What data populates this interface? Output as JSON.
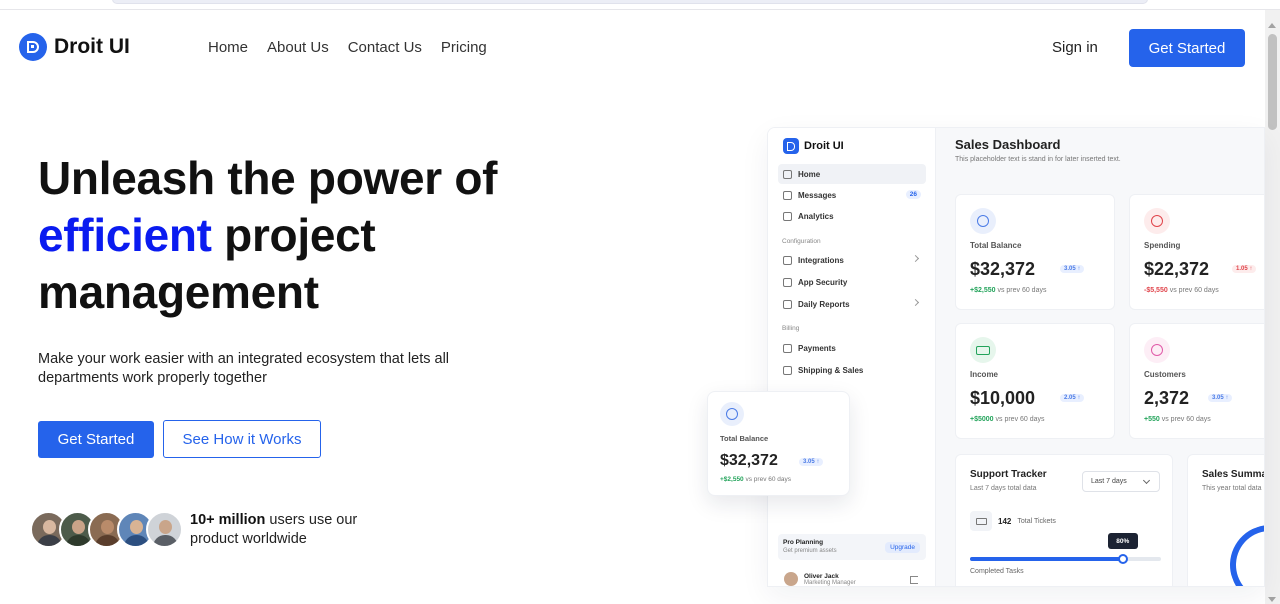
{
  "nav": {
    "brand": "Droit UI",
    "links": [
      "Home",
      "About Us",
      "Contact Us",
      "Pricing"
    ],
    "signin": "Sign in",
    "cta": "Get Started"
  },
  "hero": {
    "title_line1": "Unleash the power of",
    "title_accent": "efficient",
    "title_rest": " project",
    "title_line3": "management",
    "subtitle": "Make your work easier with an integrated ecosystem that lets all departments work properly together",
    "primary_button": "Get Started",
    "secondary_button": "See How it Works",
    "social_bold": "10+ million",
    "social_rest": " users use our product worldwide"
  },
  "dashboard": {
    "brand": "Droit UI",
    "sidebar": {
      "items": [
        {
          "label": "Home",
          "icon": "home-icon"
        },
        {
          "label": "Messages",
          "icon": "message-icon",
          "badge": "26"
        },
        {
          "label": "Analytics",
          "icon": "chart-icon"
        }
      ],
      "section_config": "Configuration",
      "config_items": [
        {
          "label": "Integrations",
          "icon": "puzzle-icon"
        },
        {
          "label": "App Security",
          "icon": "shield-icon"
        },
        {
          "label": "Daily Reports",
          "icon": "report-icon"
        }
      ],
      "section_billing": "Billing",
      "billing_items": [
        {
          "label": "Payments",
          "icon": "payments-icon"
        },
        {
          "label": "Shipping & Sales",
          "icon": "box-icon"
        }
      ],
      "plan_title": "Pro Planning",
      "plan_sub": "Get premium assets",
      "plan_button": "Upgrade",
      "user_name": "Oliver Jack",
      "user_role": "Marketing Manager"
    },
    "title": "Sales Dashboard",
    "subtitle": "This placeholder text is stand in for later inserted text.",
    "cards": [
      {
        "label": "Total Balance",
        "value": "$32,372",
        "chip": "3.05 ↑",
        "delta": "+$2,550",
        "foot": " vs prev 60 days",
        "tone": "pos",
        "icon": "database-icon"
      },
      {
        "label": "Spending",
        "value": "$22,372",
        "chip": "1.05 ↑",
        "delta": "-$5,550",
        "foot": " vs prev 60 days",
        "tone": "neg",
        "icon": "dollar-icon"
      },
      {
        "label": "Income",
        "value": "$10,000",
        "chip": "2.05 ↑",
        "delta": "+$5000",
        "foot": " vs prev 60 days",
        "tone": "pos",
        "icon": "cash-icon"
      },
      {
        "label": "Customers",
        "value": "2,372",
        "chip": "3.05 ↑",
        "delta": "+550",
        "foot": " vs prev 60 days",
        "tone": "pos",
        "icon": "users-icon"
      }
    ],
    "tracker": {
      "title": "Support Tracker",
      "sub": "Last 7 days total data",
      "select": "Last 7 days",
      "tickets_num": "142",
      "tickets_label": "Total Tickets",
      "progress": 80,
      "progress_label": "80%",
      "completed": "Completed Tasks"
    },
    "sales": {
      "title": "Sales Summary",
      "sub": "This year total data"
    }
  },
  "float_card": {
    "label": "Total Balance",
    "value": "$32,372",
    "chip": "3.05 ↑",
    "delta": "+$2,550",
    "foot": " vs prev 60 days"
  },
  "colors": {
    "primary": "#2563eb",
    "accent_text": "#0a1bf0",
    "positive": "#22a35a",
    "negative": "#e0444b"
  }
}
